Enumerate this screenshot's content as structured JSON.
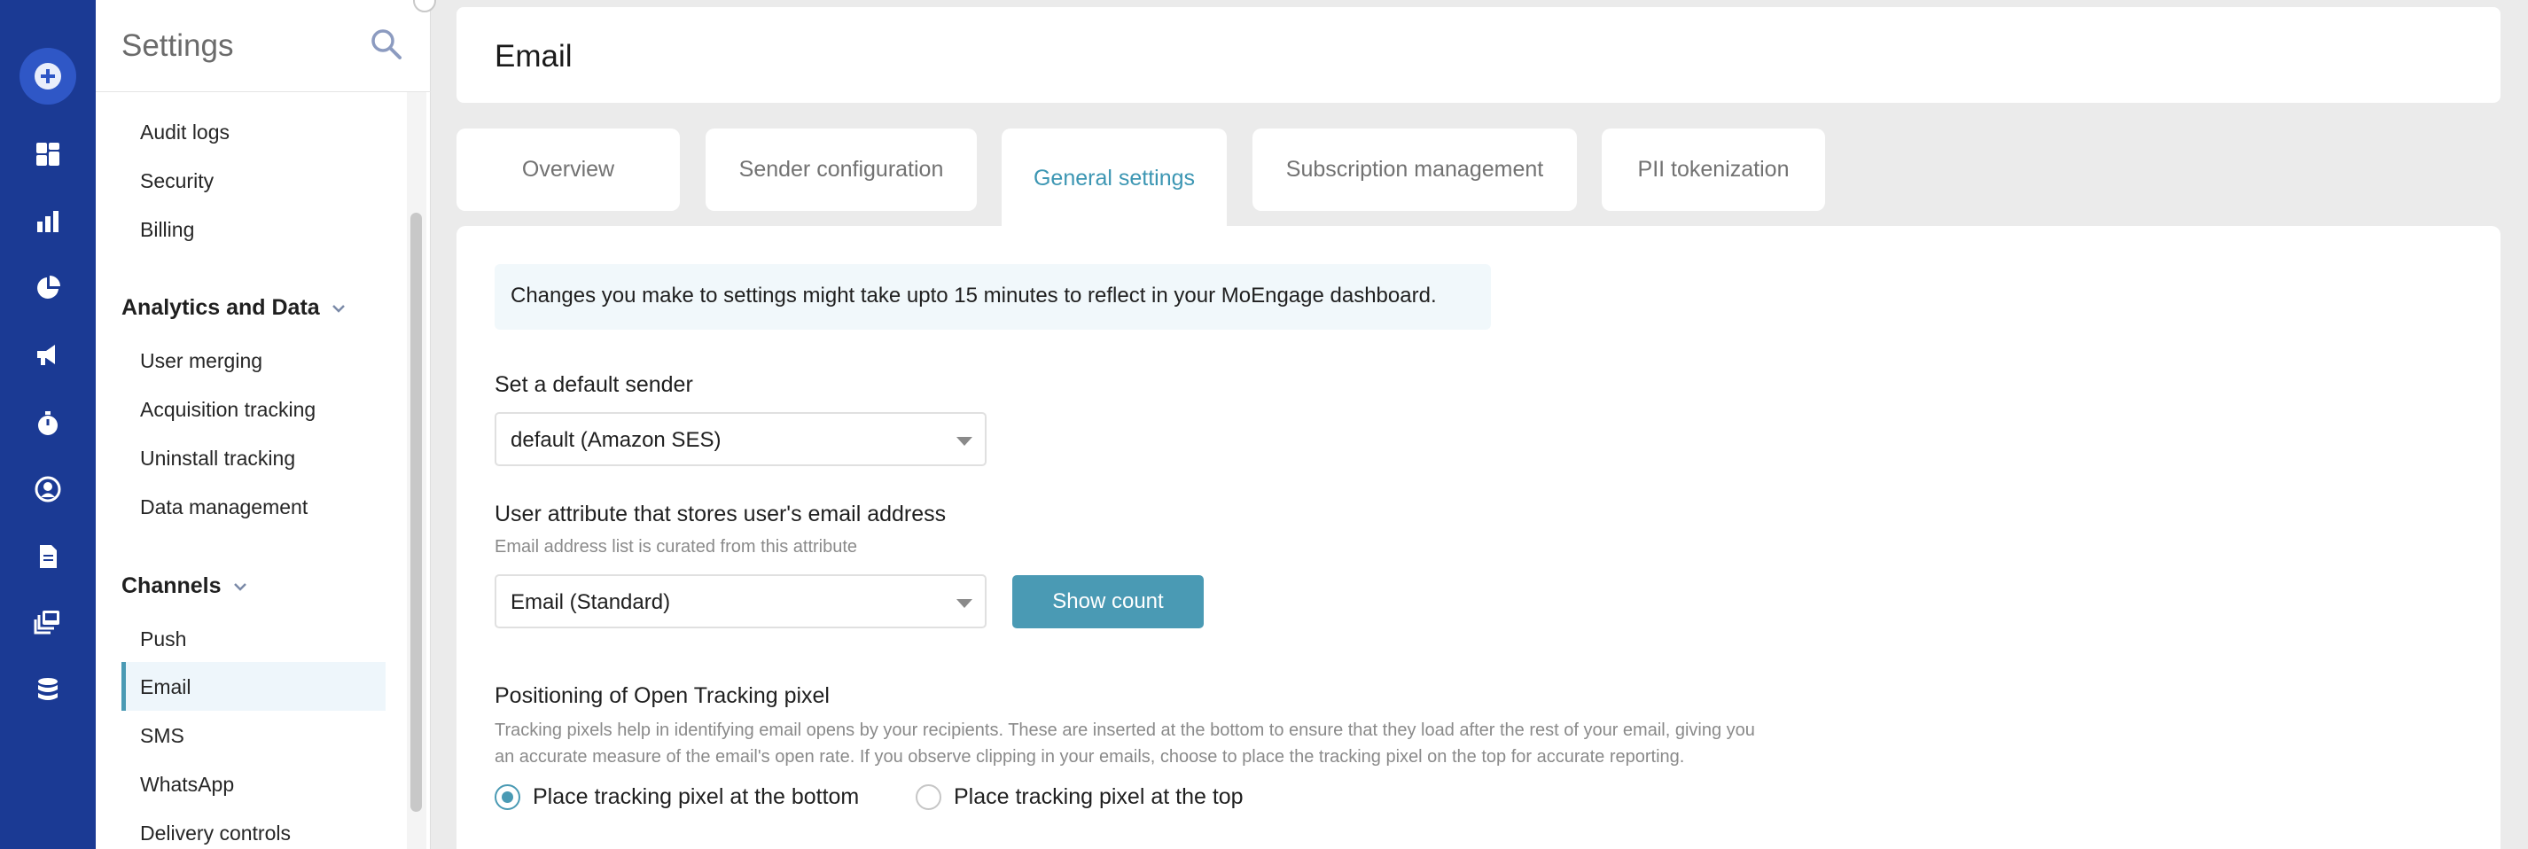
{
  "colors": {
    "rail": "#1b3a94",
    "accent": "#4a9ab4",
    "active_tab_text": "#3c96b3"
  },
  "rail": {
    "icons": [
      "add-icon",
      "dashboard-icon",
      "analytics-bar-icon",
      "pie-chart-icon",
      "megaphone-icon",
      "timer-icon",
      "user-circle-icon",
      "document-icon",
      "templates-icon",
      "database-icon"
    ]
  },
  "sidebar": {
    "title": "Settings",
    "items_top": [
      "Audit logs",
      "Security",
      "Billing"
    ],
    "analytics_group": "Analytics and Data",
    "analytics_items": [
      "User merging",
      "Acquisition tracking",
      "Uninstall tracking",
      "Data management"
    ],
    "channels_group": "Channels",
    "channels_items": [
      "Push",
      "Email",
      "SMS",
      "WhatsApp",
      "Delivery controls"
    ],
    "active_item": "Email"
  },
  "page": {
    "title": "Email",
    "tabs": [
      "Overview",
      "Sender configuration",
      "General settings",
      "Subscription management",
      "PII tokenization"
    ],
    "active_tab": "General settings"
  },
  "general": {
    "notice": "Changes you make to settings might take upto 15 minutes to reflect in your MoEngage dashboard.",
    "default_sender_label": "Set a default sender",
    "default_sender_value": "default (Amazon SES)",
    "email_attr_label": "User attribute that stores user's email address",
    "email_attr_help": "Email address list is curated from this attribute",
    "email_attr_value": "Email (Standard)",
    "show_count_label": "Show count",
    "pixel_label": "Positioning of Open Tracking pixel",
    "pixel_help_line1": "Tracking pixels help in identifying email opens by your recipients. These are inserted at the bottom to ensure that they load after the rest of your email, giving you",
    "pixel_help_line2": "an accurate measure of the email's open rate. If you observe clipping in your emails, choose to place the tracking pixel on the top for accurate reporting.",
    "radio_bottom": "Place tracking pixel at the bottom",
    "radio_top": "Place tracking pixel at the top",
    "radio_selected": "bottom"
  }
}
